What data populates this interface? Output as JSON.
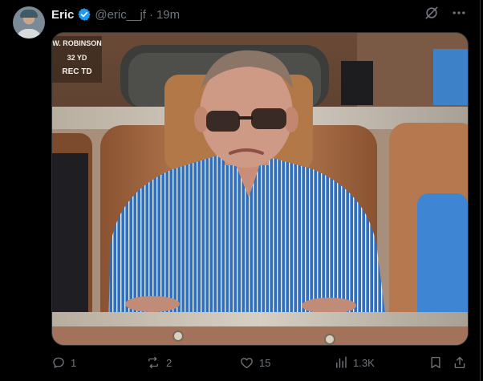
{
  "post": {
    "author_name": "Eric",
    "author_handle": "@eric__jf",
    "separator": "·",
    "timestamp": "19m",
    "verified_color": "#1d9bf0"
  },
  "media": {
    "scoreboard_lines": [
      "W. ROBINSON",
      "32 YD",
      "REC TD"
    ]
  },
  "actions": {
    "replies": "1",
    "reposts": "2",
    "likes": "15",
    "views": "1.3K"
  },
  "colors": {
    "background": "#000000",
    "text_primary": "#e7e9ea",
    "text_secondary": "#71767b",
    "border": "#2f3336"
  },
  "icons": [
    "grok-icon",
    "more-icon",
    "reply-icon",
    "repost-icon",
    "like-icon",
    "views-icon",
    "bookmark-icon",
    "share-icon"
  ]
}
